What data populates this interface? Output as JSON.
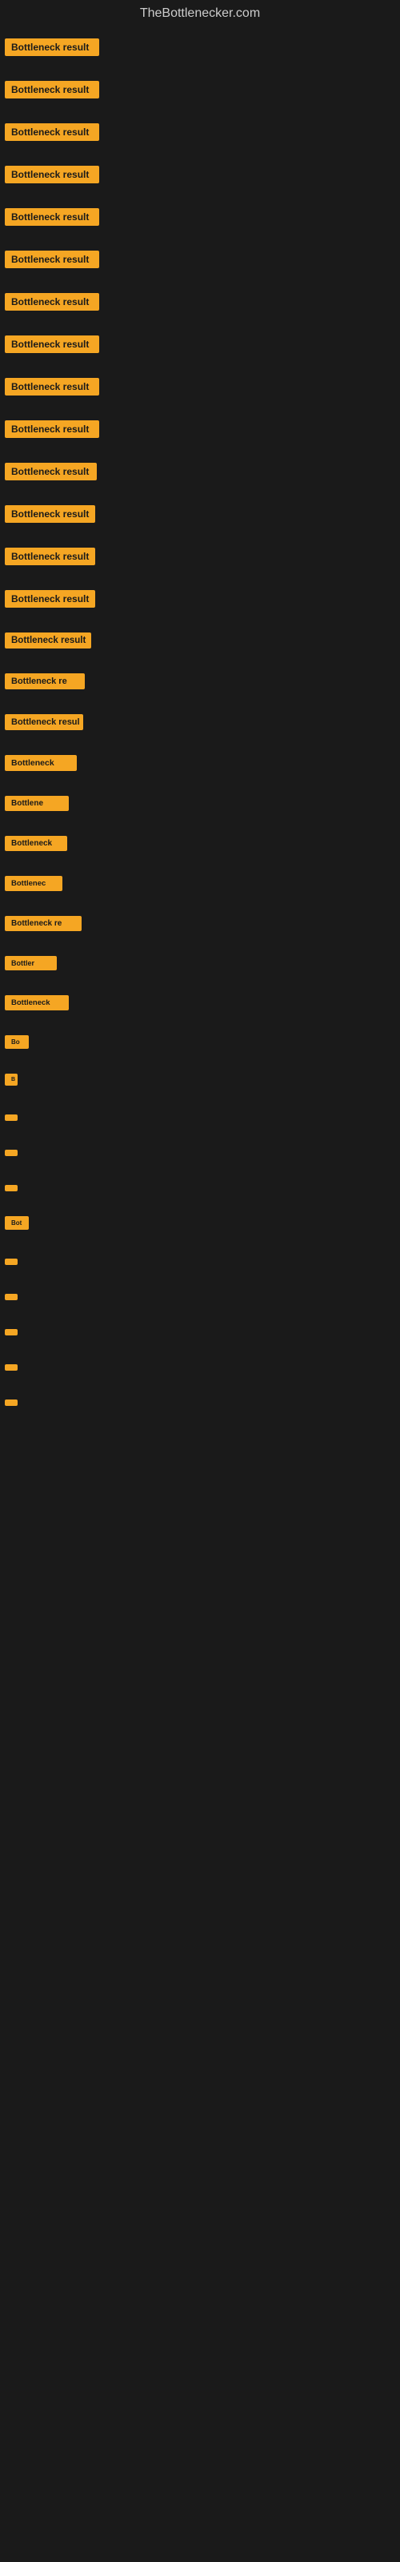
{
  "site": {
    "title": "TheBottlenecker.com"
  },
  "items": [
    {
      "id": 1,
      "label": "Bottleneck result"
    },
    {
      "id": 2,
      "label": "Bottleneck result"
    },
    {
      "id": 3,
      "label": "Bottleneck result"
    },
    {
      "id": 4,
      "label": "Bottleneck result"
    },
    {
      "id": 5,
      "label": "Bottleneck result"
    },
    {
      "id": 6,
      "label": "Bottleneck result"
    },
    {
      "id": 7,
      "label": "Bottleneck result"
    },
    {
      "id": 8,
      "label": "Bottleneck result"
    },
    {
      "id": 9,
      "label": "Bottleneck result"
    },
    {
      "id": 10,
      "label": "Bottleneck result"
    },
    {
      "id": 11,
      "label": "Bottleneck result"
    },
    {
      "id": 12,
      "label": "Bottleneck result"
    },
    {
      "id": 13,
      "label": "Bottleneck result"
    },
    {
      "id": 14,
      "label": "Bottleneck result"
    },
    {
      "id": 15,
      "label": "Bottleneck result"
    },
    {
      "id": 16,
      "label": "Bottleneck re"
    },
    {
      "id": 17,
      "label": "Bottleneck resul"
    },
    {
      "id": 18,
      "label": "Bottleneck"
    },
    {
      "id": 19,
      "label": "Bottlene"
    },
    {
      "id": 20,
      "label": "Bottleneck"
    },
    {
      "id": 21,
      "label": "Bottlenec"
    },
    {
      "id": 22,
      "label": "Bottleneck re"
    },
    {
      "id": 23,
      "label": "Bottler"
    },
    {
      "id": 24,
      "label": "Bottleneck"
    },
    {
      "id": 25,
      "label": "Bo"
    },
    {
      "id": 26,
      "label": "B"
    },
    {
      "id": 27,
      "label": ""
    },
    {
      "id": 28,
      "label": ""
    },
    {
      "id": 29,
      "label": ""
    },
    {
      "id": 30,
      "label": "Bot"
    },
    {
      "id": 31,
      "label": ""
    },
    {
      "id": 32,
      "label": ""
    },
    {
      "id": 33,
      "label": ""
    },
    {
      "id": 34,
      "label": ""
    },
    {
      "id": 35,
      "label": ""
    }
  ]
}
